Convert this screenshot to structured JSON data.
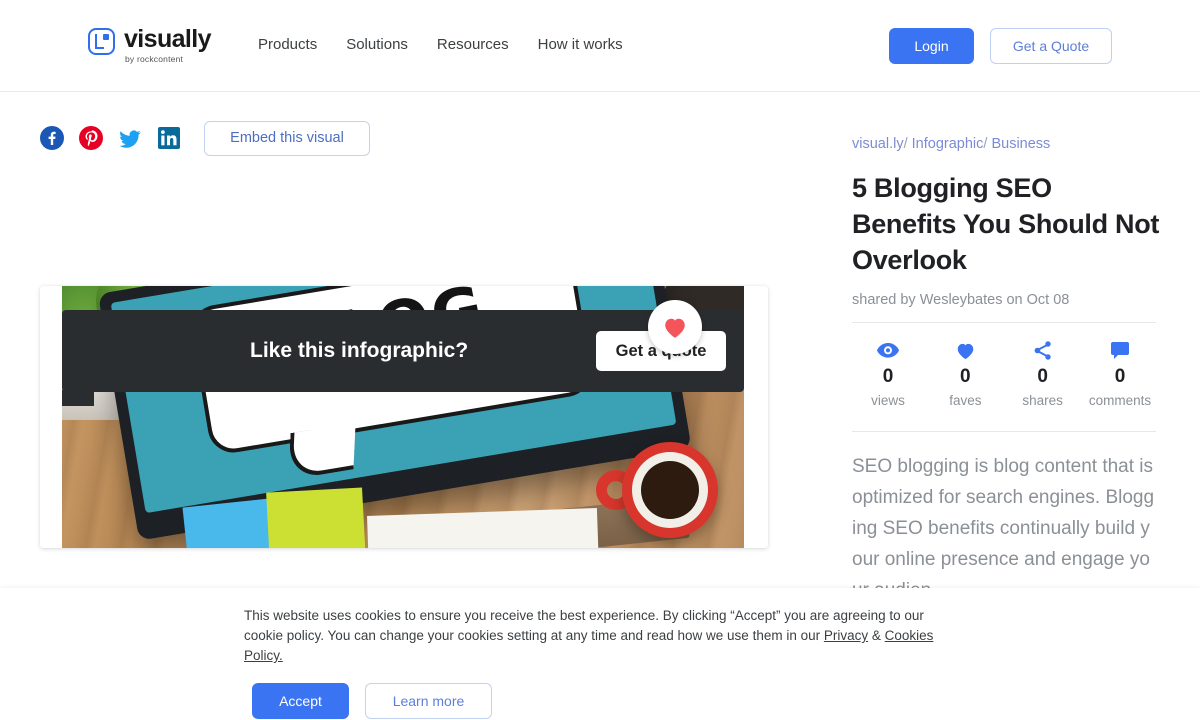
{
  "header": {
    "brand": {
      "name": "visually",
      "tagline": "by rockcontent",
      "icon": "visually-logo-icon"
    },
    "nav": [
      {
        "label": "Products"
      },
      {
        "label": "Solutions"
      },
      {
        "label": "Resources"
      },
      {
        "label": "How it works"
      }
    ],
    "login_label": "Login",
    "quote_label": "Get a Quote",
    "accent_color": "#3b74f2"
  },
  "share": {
    "networks": [
      {
        "name": "facebook-icon",
        "color": "#1b57b5"
      },
      {
        "name": "pinterest-icon",
        "color": "#e60023"
      },
      {
        "name": "twitter-icon",
        "color": "#1da1f2"
      },
      {
        "name": "linkedin-icon",
        "color": "#0a66a8"
      }
    ],
    "embed_label": "Embed this visual"
  },
  "visual": {
    "cta_text": "Like this infographic?",
    "cta_button": "Get a quote",
    "favorite_icon": "heart-icon",
    "favorite_color": "#f4545a",
    "image_alt": "BLOG written in a hand-drawn speech bubble on a computer monitor on a wooden desk with coffee mug, plant and sticky notes",
    "screen_word": "BLOG"
  },
  "details": {
    "breadcrumb": [
      "visual.ly",
      "Infographic",
      "Business"
    ],
    "breadcrumb_separator": "/",
    "title": "5 Blogging SEO Benefits You Should Not Overlook",
    "shared_by": "shared by Wesleybates on Oct 08",
    "stats": [
      {
        "icon": "eye-icon",
        "value": "0",
        "label": "views"
      },
      {
        "icon": "heart-icon",
        "value": "0",
        "label": "faves"
      },
      {
        "icon": "share-icon",
        "value": "0",
        "label": "shares"
      },
      {
        "icon": "comment-icon",
        "value": "0",
        "label": "comments"
      }
    ],
    "description": "SEO blogging is blog content that is optimized for search engines. Blogging SEO benefits continually build your online presence and engage your audien"
  },
  "cookie_banner": {
    "text_part1": "This website uses cookies to ensure you receive the best experience. By clicking “Accept” you are agreeing to our cookie policy. You can change your cookies setting at any time and read how we use them in our ",
    "privacy_link": "Privacy",
    "amp": " & ",
    "cookies_link": "Cookies Policy.",
    "accept_label": "Accept",
    "learn_label": "Learn more"
  }
}
